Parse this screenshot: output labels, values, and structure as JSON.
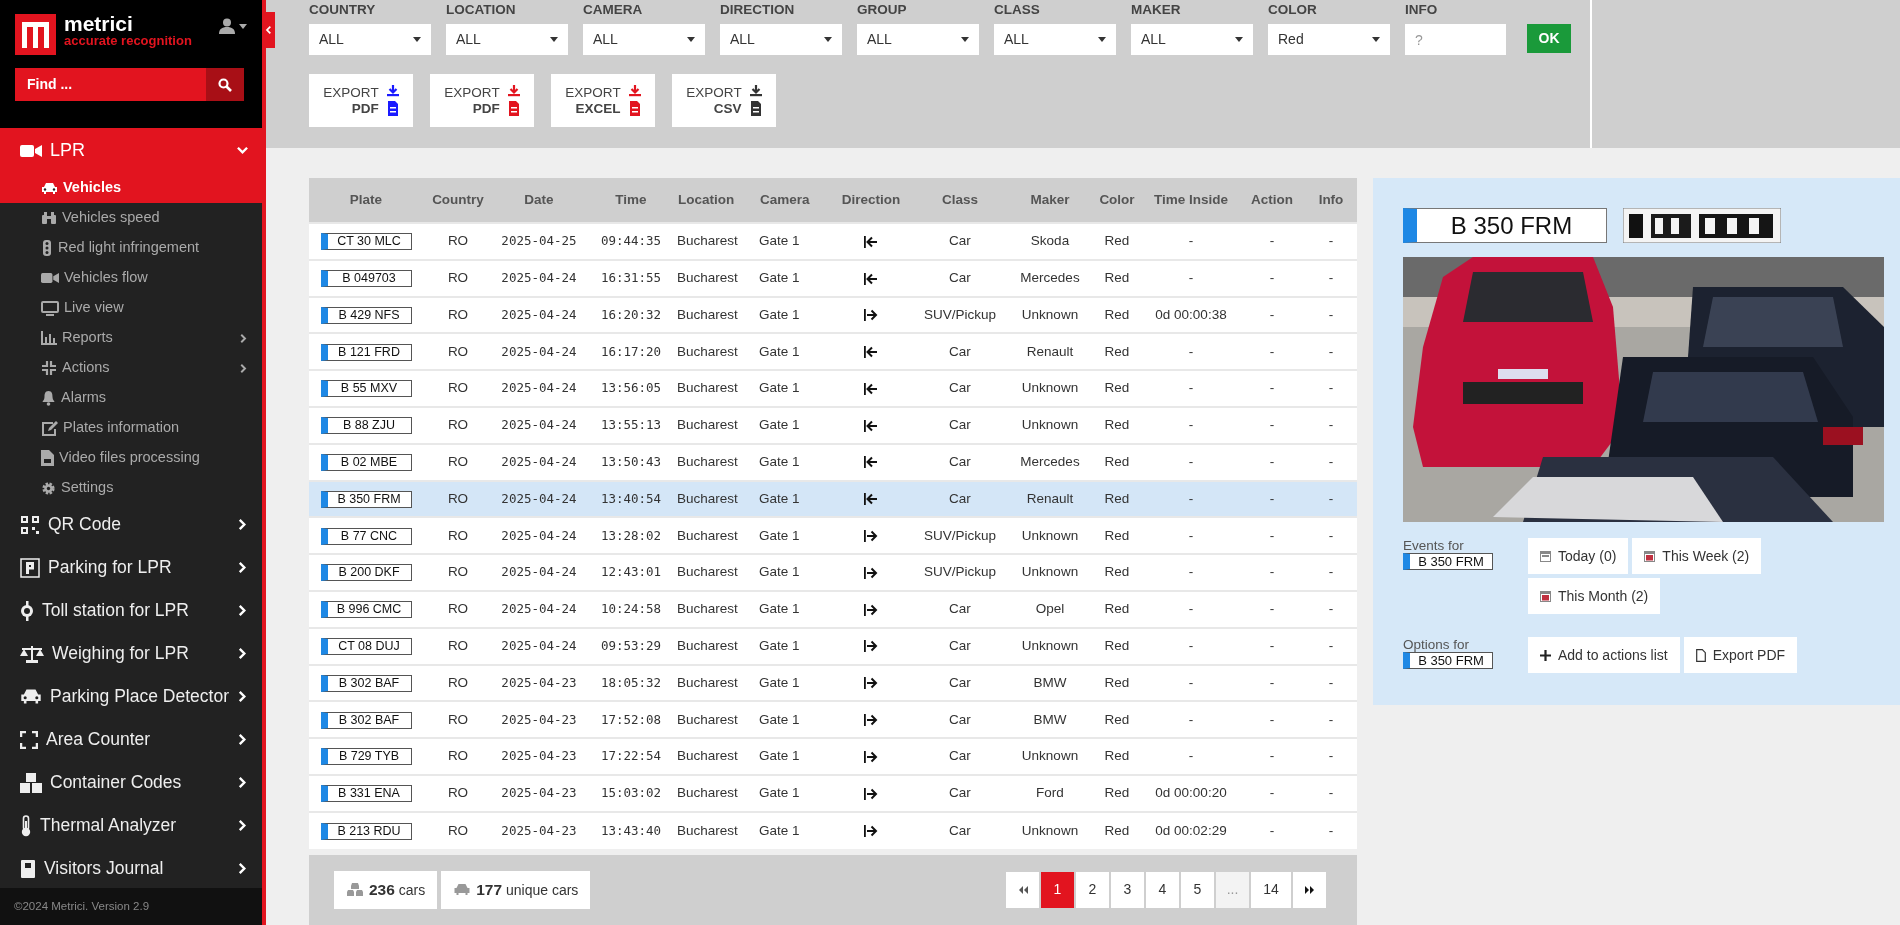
{
  "sidebar": {
    "logo": {
      "name": "metrici",
      "tagline": "accurate recognition"
    },
    "search": {
      "placeholder": "Find ..."
    },
    "menu": [
      {
        "label": "LPR",
        "expanded": true,
        "children": [
          {
            "label": "Vehicles",
            "selected": true,
            "has_submenu": false
          },
          {
            "label": "Vehicles speed",
            "selected": false,
            "has_submenu": false
          },
          {
            "label": "Red light infringement",
            "selected": false,
            "has_submenu": false
          },
          {
            "label": "Vehicles flow",
            "selected": false,
            "has_submenu": false
          },
          {
            "label": "Live view",
            "selected": false,
            "has_submenu": false
          },
          {
            "label": "Reports",
            "selected": false,
            "has_submenu": true
          },
          {
            "label": "Actions",
            "selected": false,
            "has_submenu": true
          },
          {
            "label": "Alarms",
            "selected": false,
            "has_submenu": false
          },
          {
            "label": "Plates information",
            "selected": false,
            "has_submenu": false
          },
          {
            "label": "Video files processing",
            "selected": false,
            "has_submenu": false
          },
          {
            "label": "Settings",
            "selected": false,
            "has_submenu": false
          }
        ]
      },
      {
        "label": "QR Code",
        "expanded": false
      },
      {
        "label": "Parking for LPR",
        "expanded": false
      },
      {
        "label": "Toll station for LPR",
        "expanded": false
      },
      {
        "label": "Weighing for LPR",
        "expanded": false
      },
      {
        "label": "Parking Place Detector",
        "expanded": false
      },
      {
        "label": "Area Counter",
        "expanded": false
      },
      {
        "label": "Container Codes",
        "expanded": false
      },
      {
        "label": "Thermal Analyzer",
        "expanded": false
      },
      {
        "label": "Visitors Journal",
        "expanded": false
      }
    ],
    "footer": "©2024 Metrici. Version 2.9"
  },
  "filters": [
    {
      "label": "COUNTRY",
      "value": "ALL"
    },
    {
      "label": "LOCATION",
      "value": "ALL"
    },
    {
      "label": "CAMERA",
      "value": "ALL"
    },
    {
      "label": "DIRECTION",
      "value": "ALL"
    },
    {
      "label": "GROUP",
      "value": "ALL"
    },
    {
      "label": "CLASS",
      "value": "ALL"
    },
    {
      "label": "MAKER",
      "value": "ALL"
    },
    {
      "label": "COLOR",
      "value": "Red"
    }
  ],
  "info_filter": {
    "label": "INFO",
    "placeholder": "?"
  },
  "ok_button": "OK",
  "exports": [
    {
      "top": "EXPORT",
      "format": "PDF",
      "color": "#1a1aff"
    },
    {
      "top": "EXPORT",
      "format": "PDF",
      "color": "#e2141f"
    },
    {
      "top": "EXPORT",
      "format": "EXCEL",
      "color": "#e2141f"
    },
    {
      "top": "EXPORT",
      "format": "CSV",
      "color": "#333333"
    }
  ],
  "table": {
    "columns": [
      "Plate",
      "Country",
      "Date",
      "Time",
      "Location",
      "Camera",
      "Direction",
      "Class",
      "Maker",
      "Color",
      "Time Inside",
      "Action",
      "Info"
    ],
    "rows": [
      {
        "plate": "CT 30 MLC",
        "country": "RO",
        "date": "2025-04-25",
        "time": "09:44:35",
        "location": "Bucharest",
        "camera": "Gate 1",
        "kind": "left",
        "class": "Car",
        "maker": "Skoda",
        "car_color": "Red",
        "time_inside": "-",
        "action": "-",
        "info": "-",
        "selected": false
      },
      {
        "plate": "B 049703",
        "country": "RO",
        "date": "2025-04-24",
        "time": "16:31:55",
        "location": "Bucharest",
        "camera": "Gate 1",
        "kind": "left",
        "class": "Car",
        "maker": "Mercedes",
        "car_color": "Red",
        "time_inside": "-",
        "action": "-",
        "info": "-",
        "selected": false
      },
      {
        "plate": "B 429 NFS",
        "country": "RO",
        "date": "2025-04-24",
        "time": "16:20:32",
        "location": "Bucharest",
        "camera": "Gate 1",
        "kind": "right",
        "class": "SUV/Pickup",
        "maker": "Unknown",
        "car_color": "Red",
        "time_inside": "0d 00:00:38",
        "action": "-",
        "info": "-",
        "selected": false
      },
      {
        "plate": "B 121 FRD",
        "country": "RO",
        "date": "2025-04-24",
        "time": "16:17:20",
        "location": "Bucharest",
        "camera": "Gate 1",
        "kind": "left",
        "class": "Car",
        "maker": "Renault",
        "car_color": "Red",
        "time_inside": "-",
        "action": "-",
        "info": "-",
        "selected": false
      },
      {
        "plate": "B 55 MXV",
        "country": "RO",
        "date": "2025-04-24",
        "time": "13:56:05",
        "location": "Bucharest",
        "camera": "Gate 1",
        "kind": "left",
        "class": "Car",
        "maker": "Unknown",
        "car_color": "Red",
        "time_inside": "-",
        "action": "-",
        "info": "-",
        "selected": false
      },
      {
        "plate": "B 88 ZJU",
        "country": "RO",
        "date": "2025-04-24",
        "time": "13:55:13",
        "location": "Bucharest",
        "camera": "Gate 1",
        "kind": "left",
        "class": "Car",
        "maker": "Unknown",
        "car_color": "Red",
        "time_inside": "-",
        "action": "-",
        "info": "-",
        "selected": false
      },
      {
        "plate": "B 02 MBE",
        "country": "RO",
        "date": "2025-04-24",
        "time": "13:50:43",
        "location": "Bucharest",
        "camera": "Gate 1",
        "kind": "left",
        "class": "Car",
        "maker": "Mercedes",
        "car_color": "Red",
        "time_inside": "-",
        "action": "-",
        "info": "-",
        "selected": false
      },
      {
        "plate": "B 350 FRM",
        "country": "RO",
        "date": "2025-04-24",
        "time": "13:40:54",
        "location": "Bucharest",
        "camera": "Gate 1",
        "kind": "left",
        "class": "Car",
        "maker": "Renault",
        "car_color": "Red",
        "time_inside": "-",
        "action": "-",
        "info": "-",
        "selected": true
      },
      {
        "plate": "B 77 CNC",
        "country": "RO",
        "date": "2025-04-24",
        "time": "13:28:02",
        "location": "Bucharest",
        "camera": "Gate 1",
        "kind": "right",
        "class": "SUV/Pickup",
        "maker": "Unknown",
        "car_color": "Red",
        "time_inside": "-",
        "action": "-",
        "info": "-",
        "selected": false
      },
      {
        "plate": "B 200 DKF",
        "country": "RO",
        "date": "2025-04-24",
        "time": "12:43:01",
        "location": "Bucharest",
        "camera": "Gate 1",
        "kind": "right",
        "class": "SUV/Pickup",
        "maker": "Unknown",
        "car_color": "Red",
        "time_inside": "-",
        "action": "-",
        "info": "-",
        "selected": false
      },
      {
        "plate": "B 996 CMC",
        "country": "RO",
        "date": "2025-04-24",
        "time": "10:24:58",
        "location": "Bucharest",
        "camera": "Gate 1",
        "kind": "right",
        "class": "Car",
        "maker": "Opel",
        "car_color": "Red",
        "time_inside": "-",
        "action": "-",
        "info": "-",
        "selected": false
      },
      {
        "plate": "CT 08 DUJ",
        "country": "RO",
        "date": "2025-04-24",
        "time": "09:53:29",
        "location": "Bucharest",
        "camera": "Gate 1",
        "kind": "right",
        "class": "Car",
        "maker": "Unknown",
        "car_color": "Red",
        "time_inside": "-",
        "action": "-",
        "info": "-",
        "selected": false
      },
      {
        "plate": "B 302 BAF",
        "country": "RO",
        "date": "2025-04-23",
        "time": "18:05:32",
        "location": "Bucharest",
        "camera": "Gate 1",
        "kind": "right",
        "class": "Car",
        "maker": "BMW",
        "car_color": "Red",
        "time_inside": "-",
        "action": "-",
        "info": "-",
        "selected": false
      },
      {
        "plate": "B 302 BAF",
        "country": "RO",
        "date": "2025-04-23",
        "time": "17:52:08",
        "location": "Bucharest",
        "camera": "Gate 1",
        "kind": "right",
        "class": "Car",
        "maker": "BMW",
        "car_color": "Red",
        "time_inside": "-",
        "action": "-",
        "info": "-",
        "selected": false
      },
      {
        "plate": "B 729 TYB",
        "country": "RO",
        "date": "2025-04-23",
        "time": "17:22:54",
        "location": "Bucharest",
        "camera": "Gate 1",
        "kind": "right",
        "class": "Car",
        "maker": "Unknown",
        "car_color": "Red",
        "time_inside": "-",
        "action": "-",
        "info": "-",
        "selected": false
      },
      {
        "plate": "B 331 ENA",
        "country": "RO",
        "date": "2025-04-23",
        "time": "15:03:02",
        "location": "Bucharest",
        "camera": "Gate 1",
        "kind": "right",
        "class": "Car",
        "maker": "Ford",
        "car_color": "Red",
        "time_inside": "0d 00:00:20",
        "action": "-",
        "info": "-",
        "selected": false
      },
      {
        "plate": "B 213 RDU",
        "country": "RO",
        "date": "2025-04-23",
        "time": "13:43:40",
        "location": "Bucharest",
        "camera": "Gate 1",
        "kind": "right",
        "class": "Car",
        "maker": "Unknown",
        "car_color": "Red",
        "time_inside": "0d 00:02:29",
        "action": "-",
        "info": "-",
        "selected": false
      }
    ]
  },
  "counters": [
    "**236** cars",
    "**177** unique cars"
  ],
  "pagination": [
    {
      "label": "1",
      "selected": true,
      "disabled": false
    },
    {
      "label": "2",
      "selected": false,
      "disabled": false
    },
    {
      "label": "3",
      "selected": false,
      "disabled": false
    },
    {
      "label": "4",
      "selected": false,
      "disabled": false
    },
    {
      "label": "5",
      "selected": false,
      "disabled": false
    },
    {
      "label": "...",
      "selected": false,
      "disabled": true
    },
    {
      "label": "14",
      "selected": false,
      "disabled": false
    }
  ],
  "detail": {
    "plate": "B 350 FRM",
    "events": {
      "label": "Events for",
      "plate": "B 350 FRM",
      "buttons": [
        "Today (0)",
        "This Week (2)",
        "This Month (2)"
      ]
    },
    "options": {
      "label": "Options for",
      "plate": "B 350 FRM",
      "buttons": [
        "Add to actions list",
        "Export PDF"
      ]
    }
  }
}
